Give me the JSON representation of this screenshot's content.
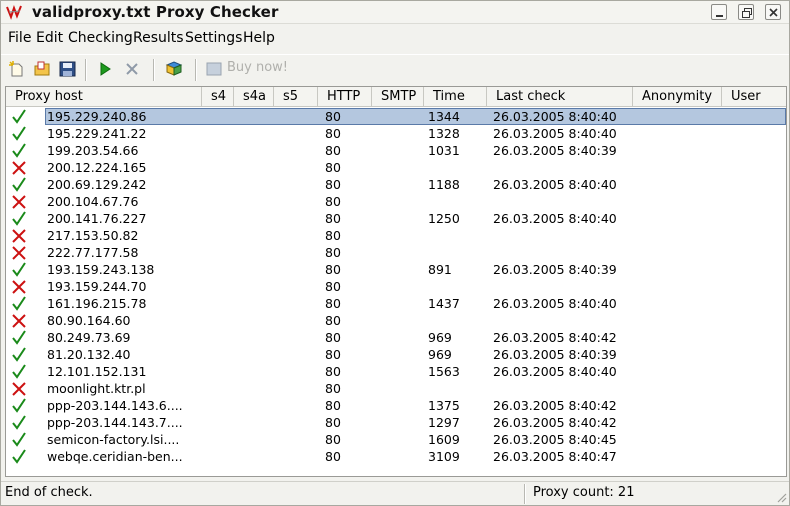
{
  "window": {
    "title": "validproxy.txt Proxy Checker"
  },
  "menu": [
    "File",
    "Edit",
    "Checking",
    "Results",
    "Settings",
    "Help"
  ],
  "toolbar": {
    "buy_label": "Buy now!",
    "icons": [
      "new-file-icon",
      "open-folder-icon",
      "save-icon",
      "start-check-icon",
      "stop-check-icon",
      "help-book-icon",
      "buy-now-icon"
    ]
  },
  "columns": [
    "Proxy host",
    "s4",
    "s4a",
    "s5",
    "HTTP",
    "SMTP",
    "Time",
    "Last check",
    "Anonymity",
    "User"
  ],
  "colors": {
    "ok": "#1a8a1a",
    "fail": "#cc1111",
    "selection": "#b4c7df"
  },
  "rows": [
    {
      "ok": true,
      "host": "195.229.240.86",
      "http": "80",
      "time": "1344",
      "last": "26.03.2005 8:40:40"
    },
    {
      "ok": true,
      "host": "195.229.241.22",
      "http": "80",
      "time": "1328",
      "last": "26.03.2005 8:40:40"
    },
    {
      "ok": true,
      "host": "199.203.54.66",
      "http": "80",
      "time": "1031",
      "last": "26.03.2005 8:40:39"
    },
    {
      "ok": false,
      "host": "200.12.224.165",
      "http": "80",
      "time": "",
      "last": ""
    },
    {
      "ok": true,
      "host": "200.69.129.242",
      "http": "80",
      "time": "1188",
      "last": "26.03.2005 8:40:40"
    },
    {
      "ok": false,
      "host": "200.104.67.76",
      "http": "80",
      "time": "",
      "last": ""
    },
    {
      "ok": true,
      "host": "200.141.76.227",
      "http": "80",
      "time": "1250",
      "last": "26.03.2005 8:40:40"
    },
    {
      "ok": false,
      "host": "217.153.50.82",
      "http": "80",
      "time": "",
      "last": ""
    },
    {
      "ok": false,
      "host": "222.77.177.58",
      "http": "80",
      "time": "",
      "last": ""
    },
    {
      "ok": true,
      "host": "193.159.243.138",
      "http": "80",
      "time": "891",
      "last": "26.03.2005 8:40:39"
    },
    {
      "ok": false,
      "host": "193.159.244.70",
      "http": "80",
      "time": "",
      "last": ""
    },
    {
      "ok": true,
      "host": "161.196.215.78",
      "http": "80",
      "time": "1437",
      "last": "26.03.2005 8:40:40"
    },
    {
      "ok": false,
      "host": "80.90.164.60",
      "http": "80",
      "time": "",
      "last": ""
    },
    {
      "ok": true,
      "host": "80.249.73.69",
      "http": "80",
      "time": "969",
      "last": "26.03.2005 8:40:42"
    },
    {
      "ok": true,
      "host": "81.20.132.40",
      "http": "80",
      "time": "969",
      "last": "26.03.2005 8:40:39"
    },
    {
      "ok": true,
      "host": "12.101.152.131",
      "http": "80",
      "time": "1563",
      "last": "26.03.2005 8:40:40"
    },
    {
      "ok": false,
      "host": "moonlight.ktr.pl",
      "http": "80",
      "time": "",
      "last": ""
    },
    {
      "ok": true,
      "host": "ppp-203.144.143.6....",
      "http": "80",
      "time": "1375",
      "last": "26.03.2005 8:40:42"
    },
    {
      "ok": true,
      "host": "ppp-203.144.143.7....",
      "http": "80",
      "time": "1297",
      "last": "26.03.2005 8:40:42"
    },
    {
      "ok": true,
      "host": "semicon-factory.lsi....",
      "http": "80",
      "time": "1609",
      "last": "26.03.2005 8:40:45"
    },
    {
      "ok": true,
      "host": "webqe.ceridian-ben...",
      "http": "80",
      "time": "3109",
      "last": "26.03.2005 8:40:47"
    }
  ],
  "status": {
    "left": "End of check.",
    "right": "Proxy count: 21"
  }
}
